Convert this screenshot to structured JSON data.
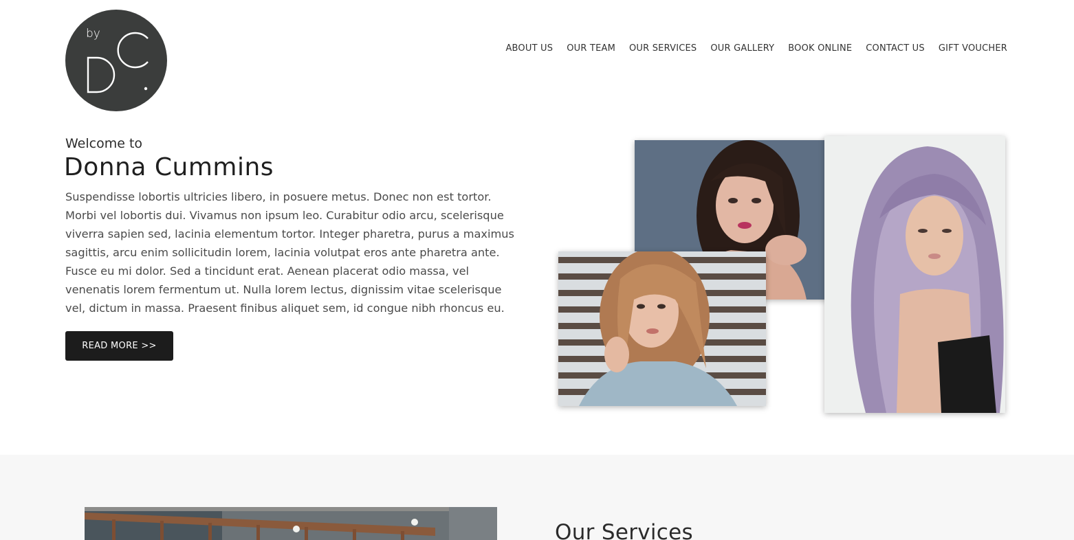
{
  "brand": {
    "logo_top_text": "by",
    "logo_letters": "DC."
  },
  "nav": [
    "ABOUT US",
    "OUR TEAM",
    "OUR SERVICES",
    "OUR GALLERY",
    "BOOK ONLINE",
    "CONTACT US",
    "GIFT VOUCHER"
  ],
  "hero": {
    "welcome": "Welcome to",
    "name": "Donna Cummins",
    "intro": "Suspendisse lobortis ultricies libero, in posuere metus. Donec non est tortor. Morbi vel lobortis dui. Vivamus non ipsum leo. Curabitur odio arcu, scelerisque viverra sapien sed, lacinia elementum tortor. Integer pharetra, purus a maximus sagittis, arcu enim sollicitudin lorem, lacinia volutpat eros ante pharetra ante. Fusce eu mi dolor. Sed a tincidunt erat. Aenean placerat odio massa, vel venenatis lorem fermentum ut. Nulla lorem lectus, dignissim vitae scelerisque vel, dictum in massa. Praesent finibus aliquet sem, id congue nibh rhoncus eu.",
    "read_more": "READ MORE >>"
  },
  "services": {
    "title": "Our Services"
  },
  "colors": {
    "logo_bg": "#3b3d3c",
    "button_bg": "#1c1c1c",
    "band_bg": "#f7f7f7"
  }
}
